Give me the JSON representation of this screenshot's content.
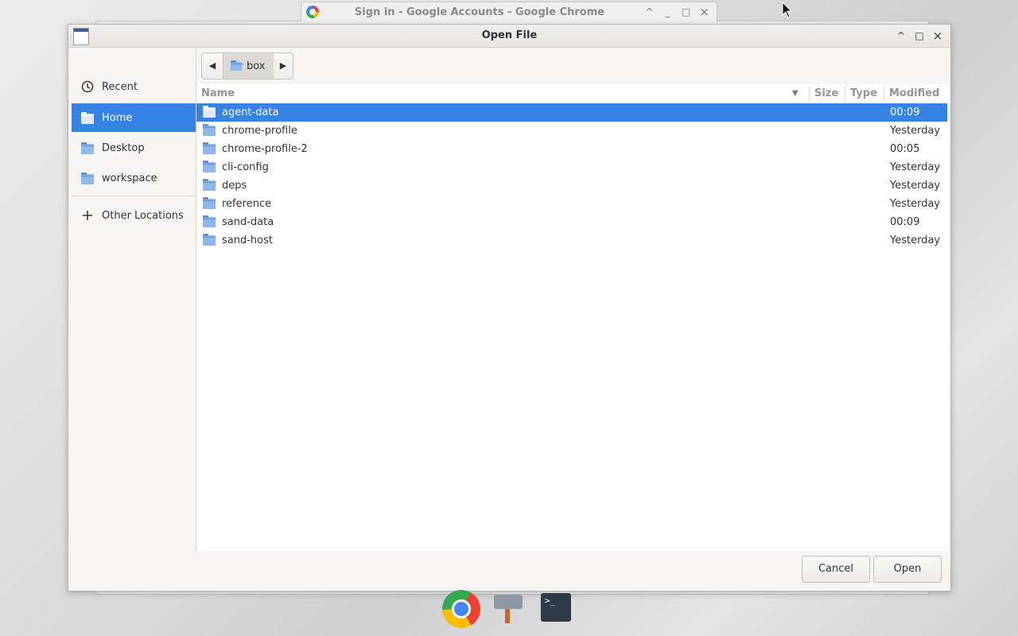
{
  "background_window": {
    "title": "Sign in - Google Accounts - Google Chrome",
    "controls": [
      "^",
      "_",
      "□",
      "×"
    ]
  },
  "dialog": {
    "title": "Open File",
    "controls": [
      "^",
      "□",
      "×"
    ]
  },
  "sidebar": {
    "items": [
      {
        "label": "Recent",
        "icon": "clock-icon"
      },
      {
        "label": "Home",
        "icon": "home-folder-icon",
        "active": true
      },
      {
        "label": "Desktop",
        "icon": "desktop-folder-icon"
      },
      {
        "label": "workspace",
        "icon": "folder-icon"
      },
      {
        "label": "Other Locations",
        "icon": "plus-icon"
      }
    ]
  },
  "pathbar": {
    "current": "box",
    "back_glyph": "◀",
    "forward_glyph": "▶"
  },
  "columns": {
    "name": "Name",
    "size": "Size",
    "type": "Type",
    "modified": "Modified",
    "sort_glyph": "▼"
  },
  "files": [
    {
      "name": "agent-data",
      "modified": "00:09",
      "selected": true
    },
    {
      "name": "chrome-profile",
      "modified": "Yesterday"
    },
    {
      "name": "chrome-profile-2",
      "modified": "00:05"
    },
    {
      "name": "cli-config",
      "modified": "Yesterday"
    },
    {
      "name": "deps",
      "modified": "Yesterday"
    },
    {
      "name": "reference",
      "modified": "Yesterday"
    },
    {
      "name": "sand-data",
      "modified": "00:09"
    },
    {
      "name": "sand-host",
      "modified": "Yesterday"
    }
  ],
  "footer": {
    "cancel_label": "Cancel",
    "open_label": "Open"
  },
  "taskbar": {
    "terminal_glyph": ">_"
  },
  "colors": {
    "accent": "#3584e4",
    "folder": "#8fb7ea"
  }
}
